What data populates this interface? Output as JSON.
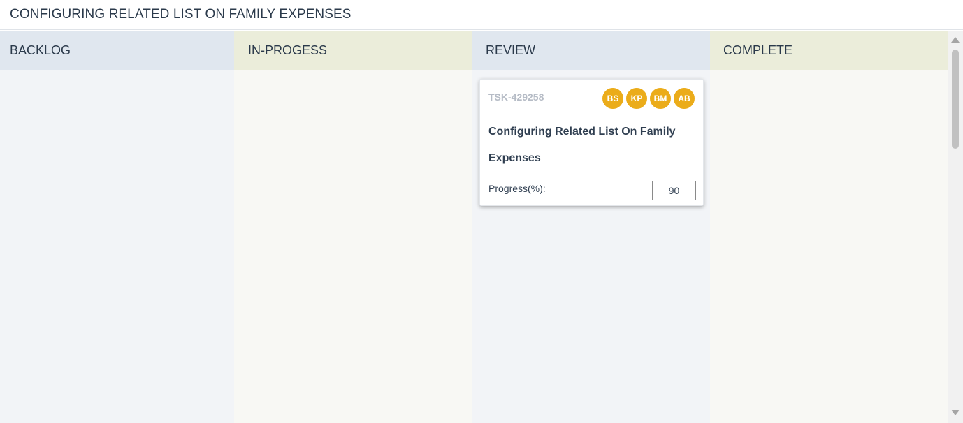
{
  "page": {
    "title": "CONFIGURING RELATED LIST ON FAMILY EXPENSES"
  },
  "board": {
    "columns": [
      {
        "label": "BACKLOG",
        "color": "#e0e7ef"
      },
      {
        "label": "IN-PROGESS",
        "color": "#ebedda"
      },
      {
        "label": "REVIEW",
        "color": "#e0e7ef"
      },
      {
        "label": "COMPLETE",
        "color": "#ebedda"
      }
    ]
  },
  "card": {
    "column": "REVIEW",
    "id": "TSK-429258",
    "assignees": [
      "BS",
      "KP",
      "BM",
      "AB"
    ],
    "avatar_color": "#ebac1a",
    "title": "Configuring Related List On Family Expenses",
    "progress_label": "Progress(%):",
    "progress_value": "90"
  },
  "scrollbar": {
    "icons": [
      "scroll-up-icon",
      "scroll-down-icon"
    ]
  }
}
